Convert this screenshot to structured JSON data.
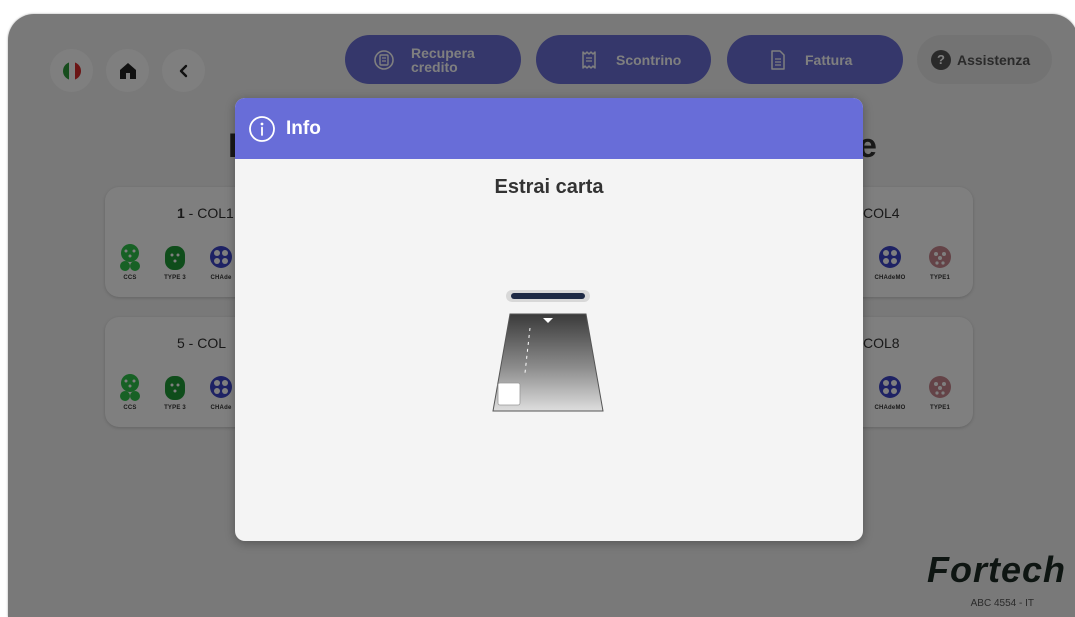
{
  "header": {
    "language_flag": "italian-flag-icon",
    "recover_credit_label_line1": "Recupera",
    "recover_credit_label_line2": "credito",
    "receipt_label": "Scontrino",
    "invoice_label": "Fattura",
    "assistance_label": "Assistenza",
    "assistance_icon": "?"
  },
  "main": {
    "title_left_fragment": "I",
    "title_right_fragment": "e",
    "columns": [
      {
        "title_number": "1",
        "title_rest": " - COL1"
      },
      {
        "title_rest": "COL4"
      },
      {
        "title_rest": "5 - COL"
      },
      {
        "title_rest": "COL8"
      }
    ],
    "connectors_left": [
      "CCS",
      "TYPE 3",
      "CHAde"
    ],
    "connectors_right": [
      "CHAdeMO",
      "TYPE1"
    ]
  },
  "modal": {
    "title": "Info",
    "message": "Estrai carta"
  },
  "footer": {
    "brand": "Fortech",
    "serial": "ABC 4554 - IT"
  },
  "colors": {
    "header_purple": "#6b6fd6",
    "modal_header": "#686dd8",
    "ccs_green": "#2ec24a",
    "type3_green": "#1f9b36",
    "chademo_blue": "#3d45c8",
    "type1_pink": "#c9868e"
  }
}
